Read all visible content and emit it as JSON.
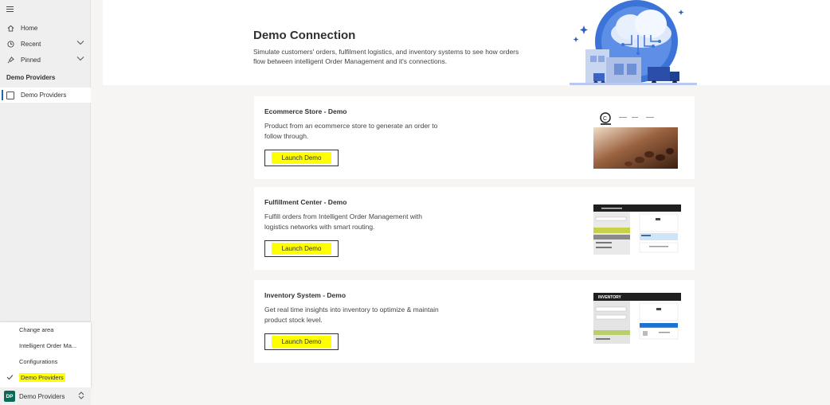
{
  "sidebar": {
    "home": "Home",
    "recent": "Recent",
    "pinned": "Pinned",
    "group_title": "Demo Providers",
    "selected_item": "Demo Providers"
  },
  "area_menu": {
    "header": "Change area",
    "items": [
      "Intelligent Order Ma...",
      "Configurations",
      "Demo Providers"
    ],
    "selected": "Demo Providers"
  },
  "area_switcher": {
    "avatar": "DP",
    "label": "Demo Providers"
  },
  "header": {
    "title": "Demo Connection",
    "description": "Simulate customers' orders, fulfilment logistics, and inventory systems to see how orders flow between intelligent Order Management and it's connections."
  },
  "cards": [
    {
      "title": "Ecommerce Store - Demo",
      "description": "Product from an ecommerce store to generate an order to follow through.",
      "button": "Launch Demo"
    },
    {
      "title": "Fulfillment Center - Demo",
      "description": "Fulfill orders from Intelligent Order Management with logistics networks with smart routing.",
      "button": "Launch Demo"
    },
    {
      "title": "Inventory System - Demo",
      "description": "Get real time insights into inventory to optimize & maintain product stock level.",
      "button": "Launch Demo"
    }
  ],
  "thumbs": {
    "inventory_title": "INVENTORY"
  },
  "colors": {
    "accent": "#0f6cbd",
    "highlight": "#ffff00",
    "avatar": "#0b6a55"
  }
}
